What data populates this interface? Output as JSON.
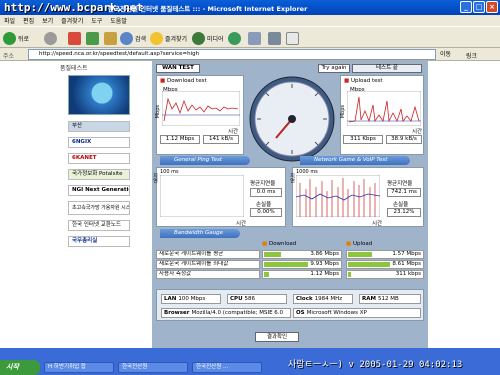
{
  "window": {
    "title": "한국전산원 인터넷 품질테스트 ::: - Microsoft Internet Explorer",
    "watermark": "http://www.bcpark.net"
  },
  "menu": [
    "파일",
    "편집",
    "보기",
    "즐겨찾기",
    "도구",
    "도움말"
  ],
  "toolbar": {
    "back": "뒤로",
    "search": "검색",
    "favorites": "즐겨찾기",
    "media": "미디어"
  },
  "address": {
    "label": "주소",
    "url": "http://speed.nca.or.kr/speedtest/default.asp?service=high",
    "go": "이동",
    "links": "링크"
  },
  "left": {
    "header": "품질테스트",
    "menu": [
      "부산",
      "6NGIX",
      "6KANET",
      "국가정보화 Potalsite",
      "NGI Next Generation",
      "초고속국가망 가용자원 시스템",
      "한국 인터넷 교환노드",
      "국무총리실"
    ]
  },
  "main": {
    "tab": "WAN TEST",
    "try_again": "Try again",
    "test_end": "테스트 끝",
    "download": {
      "title": "Download test",
      "unit": "Mbps",
      "time": "시간",
      "ylabel": "Mbps",
      "mbps": "1.12 Mbps",
      "kbs": "141 kB/s"
    },
    "upload": {
      "title": "Upload test",
      "unit": "Mbps",
      "time": "시간",
      "ylabel": "Mbps",
      "mbps": "311 Kbps",
      "kbs": "38.9 kB/s"
    },
    "ping": {
      "title": "General Ping Test",
      "yval": "100 ms",
      "ylabel": "지연",
      "time": "시간",
      "avg_label": "평균지연율",
      "avg": "0.0 ms",
      "loss_label": "손실율",
      "loss": "0.00%"
    },
    "voip": {
      "title": "Network Game & VoIP Test",
      "yval": "1000 ms",
      "ylabel": "지연",
      "time": "시간",
      "avg_label": "평균지연율",
      "avg": "742.1 ms",
      "loss_label": "손실율",
      "loss": "23.12%"
    },
    "bandwidth": {
      "title": "Bandwidth Gauge",
      "download_label": "Download",
      "upload_label": "Upload"
    },
    "rows": [
      {
        "label": "새로운국 게이트웨이를 평균",
        "download": "3.86 Mbps",
        "download_frac": 0.39,
        "upload": "1.57 Mbps",
        "upload_frac": 0.55
      },
      {
        "label": "새로운국 게이트웨이를 최대값",
        "download": "9.93 Mbps",
        "download_frac": 0.99,
        "upload": "8.61 Mbps",
        "upload_frac": 0.95
      },
      {
        "label": "사용자 측정값",
        "download": "1.12 Mbps",
        "download_frac": 0.12,
        "upload": "311 kbps",
        "upload_frac": 0.06
      }
    ],
    "system": {
      "lan_label": "LAN",
      "lan": "100 Mbps",
      "cpu_label": "CPU",
      "cpu": "586",
      "clock_label": "Clock",
      "clock": "1984 MHz",
      "ram_label": "RAM",
      "ram": "512 MB",
      "browser_label": "Browser",
      "browser": "Mozilla/4.0 (compatible; MSIE 6.0",
      "os_label": "OS",
      "os": "Microsoft Windows XP"
    },
    "result_button": "결과확인"
  },
  "taskbar": {
    "start": "시작",
    "tasks": [
      "H 하반기취업 합",
      "한국전산원",
      "한국전산원 ..."
    ],
    "clock_watermark": "사랑ㅌㅡㅅㅡ) v 2005-01-29 04:02:13"
  },
  "colors": {
    "accent": "#3E72C0",
    "gauge_fill": "#8CC63F",
    "download_line": "#CC2222",
    "panel_bg": "#9FB4CB"
  }
}
